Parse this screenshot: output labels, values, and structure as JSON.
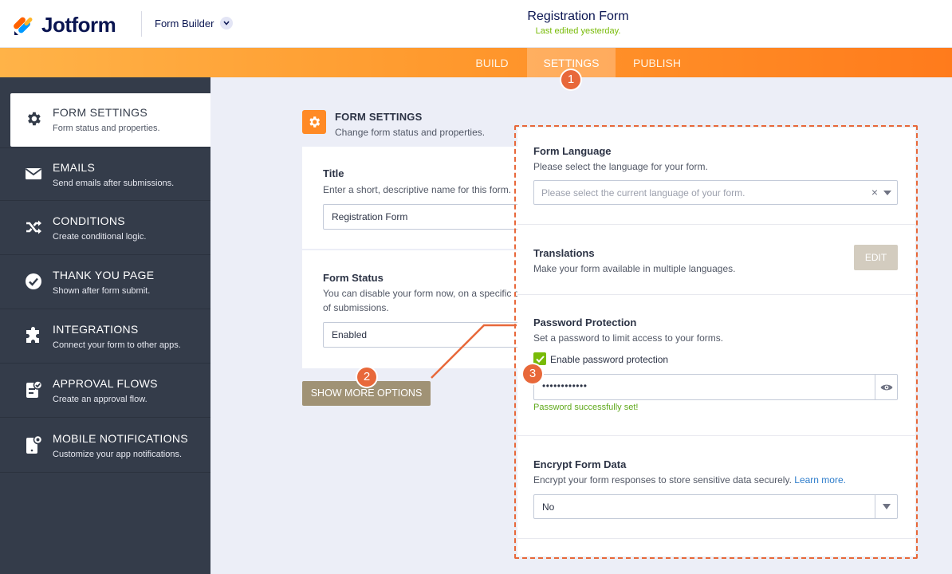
{
  "header": {
    "logo_text": "Jotform",
    "builder_label": "Form Builder",
    "form_title": "Registration Form",
    "last_edited": "Last edited yesterday."
  },
  "tabs": [
    {
      "label": "BUILD",
      "active": false
    },
    {
      "label": "SETTINGS",
      "active": true
    },
    {
      "label": "PUBLISH",
      "active": false
    }
  ],
  "sidebar": {
    "items": [
      {
        "title": "FORM SETTINGS",
        "desc": "Form status and properties.",
        "icon": "gear-icon",
        "active": true
      },
      {
        "title": "EMAILS",
        "desc": "Send emails after submissions.",
        "icon": "envelope-icon"
      },
      {
        "title": "CONDITIONS",
        "desc": "Create conditional logic.",
        "icon": "shuffle-icon"
      },
      {
        "title": "THANK YOU PAGE",
        "desc": "Shown after form submit.",
        "icon": "check-circle-icon"
      },
      {
        "title": "INTEGRATIONS",
        "desc": "Connect your form to other apps.",
        "icon": "puzzle-icon"
      },
      {
        "title": "APPROVAL FLOWS",
        "desc": "Create an approval flow.",
        "icon": "approval-icon"
      },
      {
        "title": "MOBILE NOTIFICATIONS",
        "desc": "Customize your app notifications.",
        "icon": "mobile-notification-icon"
      }
    ]
  },
  "main": {
    "section_title": "FORM SETTINGS",
    "section_desc": "Change form status and properties.",
    "title_field": {
      "label": "Title",
      "desc": "Enter a short, descriptive name for this form.",
      "value": "Registration Form"
    },
    "status_field": {
      "label": "Form Status",
      "desc_line1": "You can disable your form now, on a specific d",
      "desc_line2": "of submissions.",
      "value": "Enabled"
    },
    "more_button": "SHOW MORE OPTIONS"
  },
  "panel": {
    "language": {
      "label": "Form Language",
      "desc": "Please select the language for your form.",
      "placeholder": "Please select the current language of your form.",
      "clear": "×"
    },
    "translations": {
      "label": "Translations",
      "desc": "Make your form available in multiple languages.",
      "button": "EDIT"
    },
    "password": {
      "label": "Password Protection",
      "desc": "Set a password to limit access to your forms.",
      "checkbox_label": "Enable password protection",
      "checked": true,
      "masked_value": "••••••••••••",
      "success": "Password successfully set!"
    },
    "encrypt": {
      "label": "Encrypt Form Data",
      "desc": "Encrypt your form responses to store sensitive data securely.",
      "link": "Learn more.",
      "value": "No"
    }
  },
  "callouts": [
    "1",
    "2",
    "3"
  ],
  "colors": {
    "accent_orange": "#ff8a25",
    "callout": "#e8683a",
    "sidebar_bg": "#343c4a",
    "success_green": "#78bb07"
  }
}
